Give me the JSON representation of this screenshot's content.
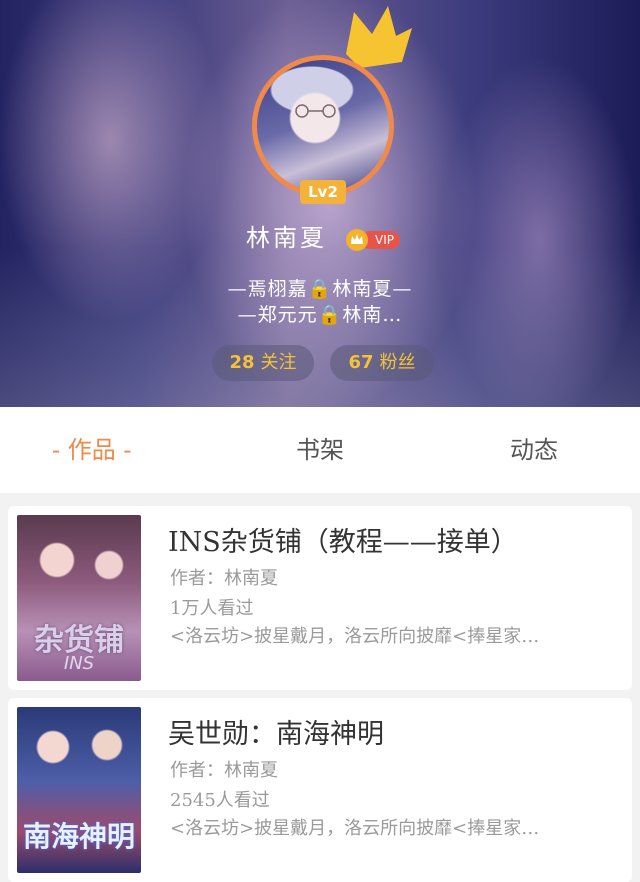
{
  "profile": {
    "level": "Lv2",
    "name": "林南夏",
    "vip_label": "VIP",
    "signature_line1": "—焉栩嘉🔒林南夏—",
    "signature_line2": "—郑元元🔒林南…",
    "following_count": "28",
    "following_label": "关注",
    "fans_count": "67",
    "fans_label": "粉丝"
  },
  "tabs": [
    {
      "label": "- 作品 -",
      "active": true
    },
    {
      "label": "书架",
      "active": false
    },
    {
      "label": "动态",
      "active": false
    }
  ],
  "books": [
    {
      "title": "INS杂货铺（教程——接单）",
      "author": "作者：林南夏",
      "views": "1万人看过",
      "description": "<洛云坊>披星戴月，洛云所向披靡<捧星家…",
      "cover_title": "杂货铺",
      "cover_sub": "INS"
    },
    {
      "title": "吴世勋：南海神明",
      "author": "作者：林南夏",
      "views": "2545人看过",
      "description": "<洛云坊>披星戴月，洛云所向披靡<捧星家…",
      "cover_title": "南海神明"
    }
  ],
  "colors": {
    "accent": "#ee8a4a",
    "stat_text": "#f4c23a",
    "level_badge": "#f4b23b",
    "vip_pill": "#e8544b"
  }
}
